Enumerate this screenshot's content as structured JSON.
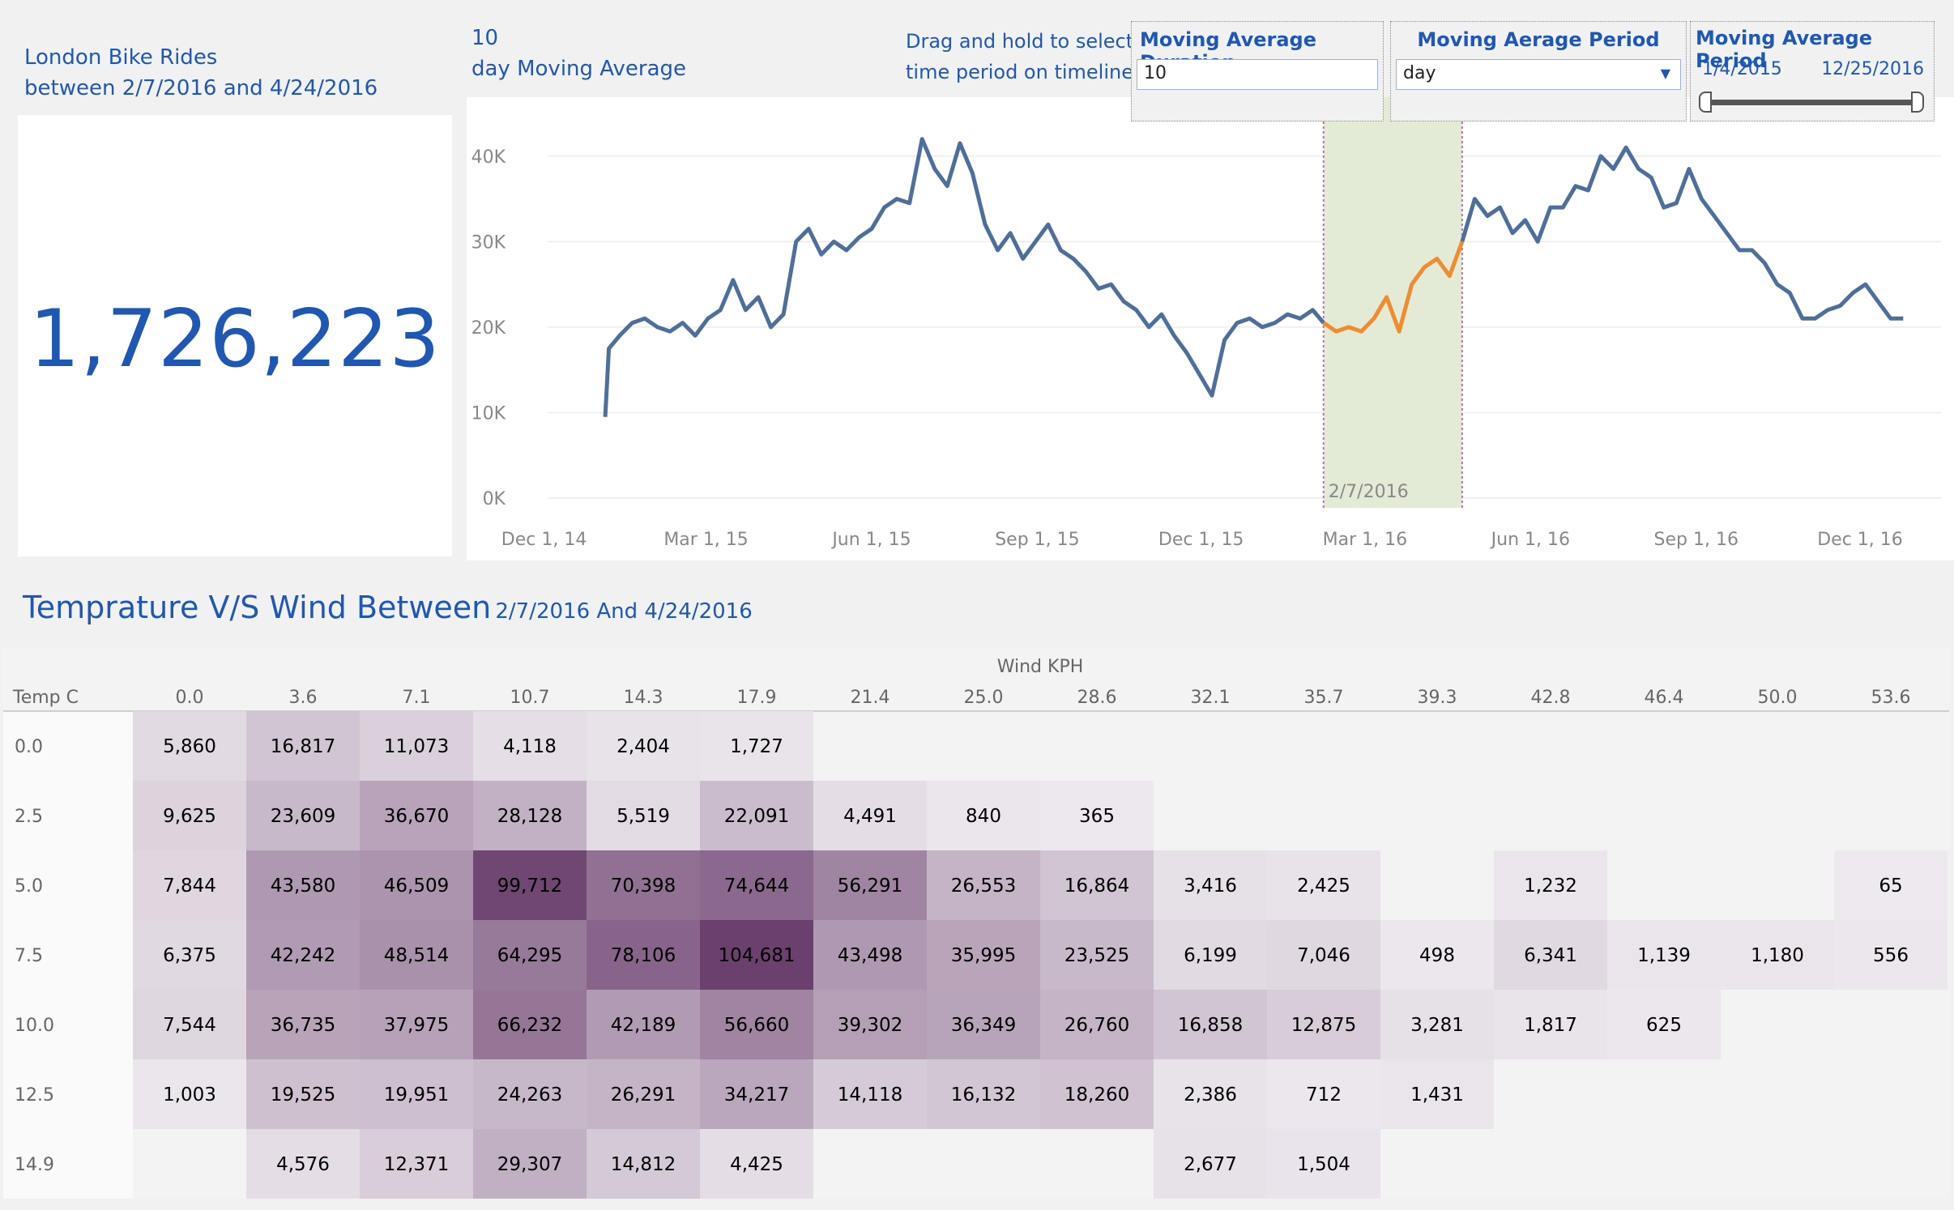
{
  "kpi": {
    "title_line1": "London Bike Rides",
    "title_line2": "between 2/7/2016 and 4/24/2016",
    "value": "1,726,223"
  },
  "moving_average": {
    "duration_value": "10",
    "heading_line2": "day Moving Average",
    "drag_hint_line1": "Drag and hold to select",
    "drag_hint_line2": "time period on timeline",
    "duration_label": "Moving Average Duration",
    "period_label": "Moving Aerage Period",
    "period_value": "day",
    "range_label": "Moving Average Period",
    "range_start": "1/4/2015",
    "range_end": "12/25/2016",
    "selection_label": "2/7/2016"
  },
  "colors": {
    "accent": "#1f57b4",
    "line": "#4e6f9c",
    "highlight_line": "#f08c2e",
    "selection_fill": "#e3ebd6",
    "heat_max": "#6b3f6e"
  },
  "heatmap_title": {
    "main": "Temprature V/S Wind Between",
    "sub": "2/7/2016 And 4/24/2016"
  },
  "chart_data": [
    {
      "type": "line",
      "y_ticks": [
        "0K",
        "10K",
        "20K",
        "30K",
        "40K"
      ],
      "x_ticks": [
        "Dec 1, 14",
        "Mar 1, 15",
        "Jun 1, 15",
        "Sep 1, 15",
        "Dec 1, 15",
        "Mar 1, 16",
        "Jun 1, 16",
        "Sep 1, 16",
        "Dec 1, 16"
      ],
      "ylim": [
        0,
        45000
      ],
      "x_range": [
        "2014-11-15",
        "2017-01-15"
      ],
      "selected_range": [
        "2016-02-07",
        "2016-04-24"
      ],
      "series": [
        {
          "x": [
            "2015-01-04",
            "2015-01-06",
            "2015-01-12",
            "2015-01-19",
            "2015-01-26",
            "2015-02-02",
            "2015-02-09",
            "2015-02-16",
            "2015-02-23",
            "2015-03-02",
            "2015-03-09",
            "2015-03-16",
            "2015-03-23",
            "2015-03-30",
            "2015-04-06",
            "2015-04-13",
            "2015-04-20",
            "2015-04-27",
            "2015-05-04",
            "2015-05-11",
            "2015-05-18",
            "2015-05-25",
            "2015-06-01",
            "2015-06-08",
            "2015-06-15",
            "2015-06-22",
            "2015-06-29",
            "2015-07-06",
            "2015-07-13",
            "2015-07-20",
            "2015-07-27",
            "2015-08-03",
            "2015-08-10",
            "2015-08-17",
            "2015-08-24",
            "2015-08-31",
            "2015-09-07",
            "2015-09-14",
            "2015-09-21",
            "2015-09-28",
            "2015-10-05",
            "2015-10-12",
            "2015-10-19",
            "2015-10-26",
            "2015-11-02",
            "2015-11-09",
            "2015-11-16",
            "2015-11-23",
            "2015-11-30",
            "2015-12-07",
            "2015-12-14",
            "2015-12-21",
            "2015-12-28",
            "2016-01-04",
            "2016-01-11",
            "2016-01-18",
            "2016-01-25",
            "2016-02-01",
            "2016-02-07",
            "2016-02-14",
            "2016-02-21",
            "2016-02-28",
            "2016-03-06",
            "2016-03-13",
            "2016-03-20",
            "2016-03-27",
            "2016-04-03",
            "2016-04-10",
            "2016-04-17",
            "2016-04-24",
            "2016-05-01",
            "2016-05-08",
            "2016-05-15",
            "2016-05-22",
            "2016-05-29",
            "2016-06-05",
            "2016-06-12",
            "2016-06-19",
            "2016-06-26",
            "2016-07-03",
            "2016-07-10",
            "2016-07-17",
            "2016-07-24",
            "2016-07-31",
            "2016-08-07",
            "2016-08-14",
            "2016-08-21",
            "2016-08-28",
            "2016-09-04",
            "2016-09-11",
            "2016-09-18",
            "2016-09-25",
            "2016-10-02",
            "2016-10-09",
            "2016-10-16",
            "2016-10-23",
            "2016-10-30",
            "2016-11-06",
            "2016-11-13",
            "2016-11-20",
            "2016-11-27",
            "2016-12-04",
            "2016-12-11",
            "2016-12-18",
            "2016-12-25"
          ],
          "values": [
            9500,
            17500,
            19000,
            20500,
            21000,
            20000,
            19500,
            20500,
            19000,
            21000,
            22000,
            25500,
            22000,
            23500,
            20000,
            21500,
            30000,
            31500,
            28500,
            30000,
            29000,
            30500,
            31500,
            34000,
            35000,
            34500,
            42000,
            38500,
            36500,
            41500,
            38000,
            32000,
            29000,
            31000,
            28000,
            30000,
            32000,
            29000,
            28000,
            26500,
            24500,
            25000,
            23000,
            22000,
            20000,
            21500,
            19000,
            17000,
            14500,
            12000,
            18500,
            20500,
            21000,
            20000,
            20500,
            21500,
            21000,
            22000,
            20500,
            19500,
            20000,
            19500,
            21000,
            23500,
            19500,
            25000,
            27000,
            28000,
            26000,
            30000,
            35000,
            33000,
            34000,
            31000,
            32500,
            30000,
            34000,
            34000,
            36500,
            36000,
            40000,
            38500,
            41000,
            38500,
            37500,
            34000,
            34500,
            38500,
            35000,
            33000,
            31000,
            29000,
            29000,
            27500,
            25000,
            24000,
            21000,
            21000,
            22000,
            22500,
            24000,
            25000,
            23000,
            21000,
            21000
          ]
        }
      ]
    },
    {
      "type": "heatmap",
      "title": "Temprature V/S Wind Between 2/7/2016 And 4/24/2016",
      "xlabel": "Wind KPH",
      "ylabel": "Temp C",
      "x_categories": [
        "0.0",
        "3.6",
        "7.1",
        "10.7",
        "14.3",
        "17.9",
        "21.4",
        "25.0",
        "28.6",
        "32.1",
        "35.7",
        "39.3",
        "42.8",
        "46.4",
        "50.0",
        "53.6"
      ],
      "y_categories": [
        "0.0",
        "2.5",
        "5.0",
        "7.5",
        "10.0",
        "12.5",
        "14.9"
      ],
      "values": [
        [
          5860,
          16817,
          11073,
          4118,
          2404,
          1727,
          null,
          null,
          null,
          null,
          null,
          null,
          null,
          null,
          null,
          null
        ],
        [
          9625,
          23609,
          36670,
          28128,
          5519,
          22091,
          4491,
          840,
          365,
          null,
          null,
          null,
          null,
          null,
          null,
          null
        ],
        [
          7844,
          43580,
          46509,
          99712,
          70398,
          74644,
          56291,
          26553,
          16864,
          3416,
          2425,
          null,
          1232,
          null,
          null,
          65
        ],
        [
          6375,
          42242,
          48514,
          64295,
          78106,
          104681,
          43498,
          35995,
          23525,
          6199,
          7046,
          498,
          6341,
          1139,
          1180,
          556
        ],
        [
          7544,
          36735,
          37975,
          66232,
          42189,
          56660,
          39302,
          36349,
          26760,
          16858,
          12875,
          3281,
          1817,
          625,
          null,
          null
        ],
        [
          1003,
          19525,
          19951,
          24263,
          26291,
          34217,
          14118,
          16132,
          18260,
          2386,
          712,
          1431,
          null,
          null,
          null,
          null
        ],
        [
          null,
          4576,
          12371,
          29307,
          14812,
          4425,
          null,
          null,
          null,
          2677,
          1504,
          null,
          null,
          null,
          null,
          null
        ]
      ]
    }
  ]
}
